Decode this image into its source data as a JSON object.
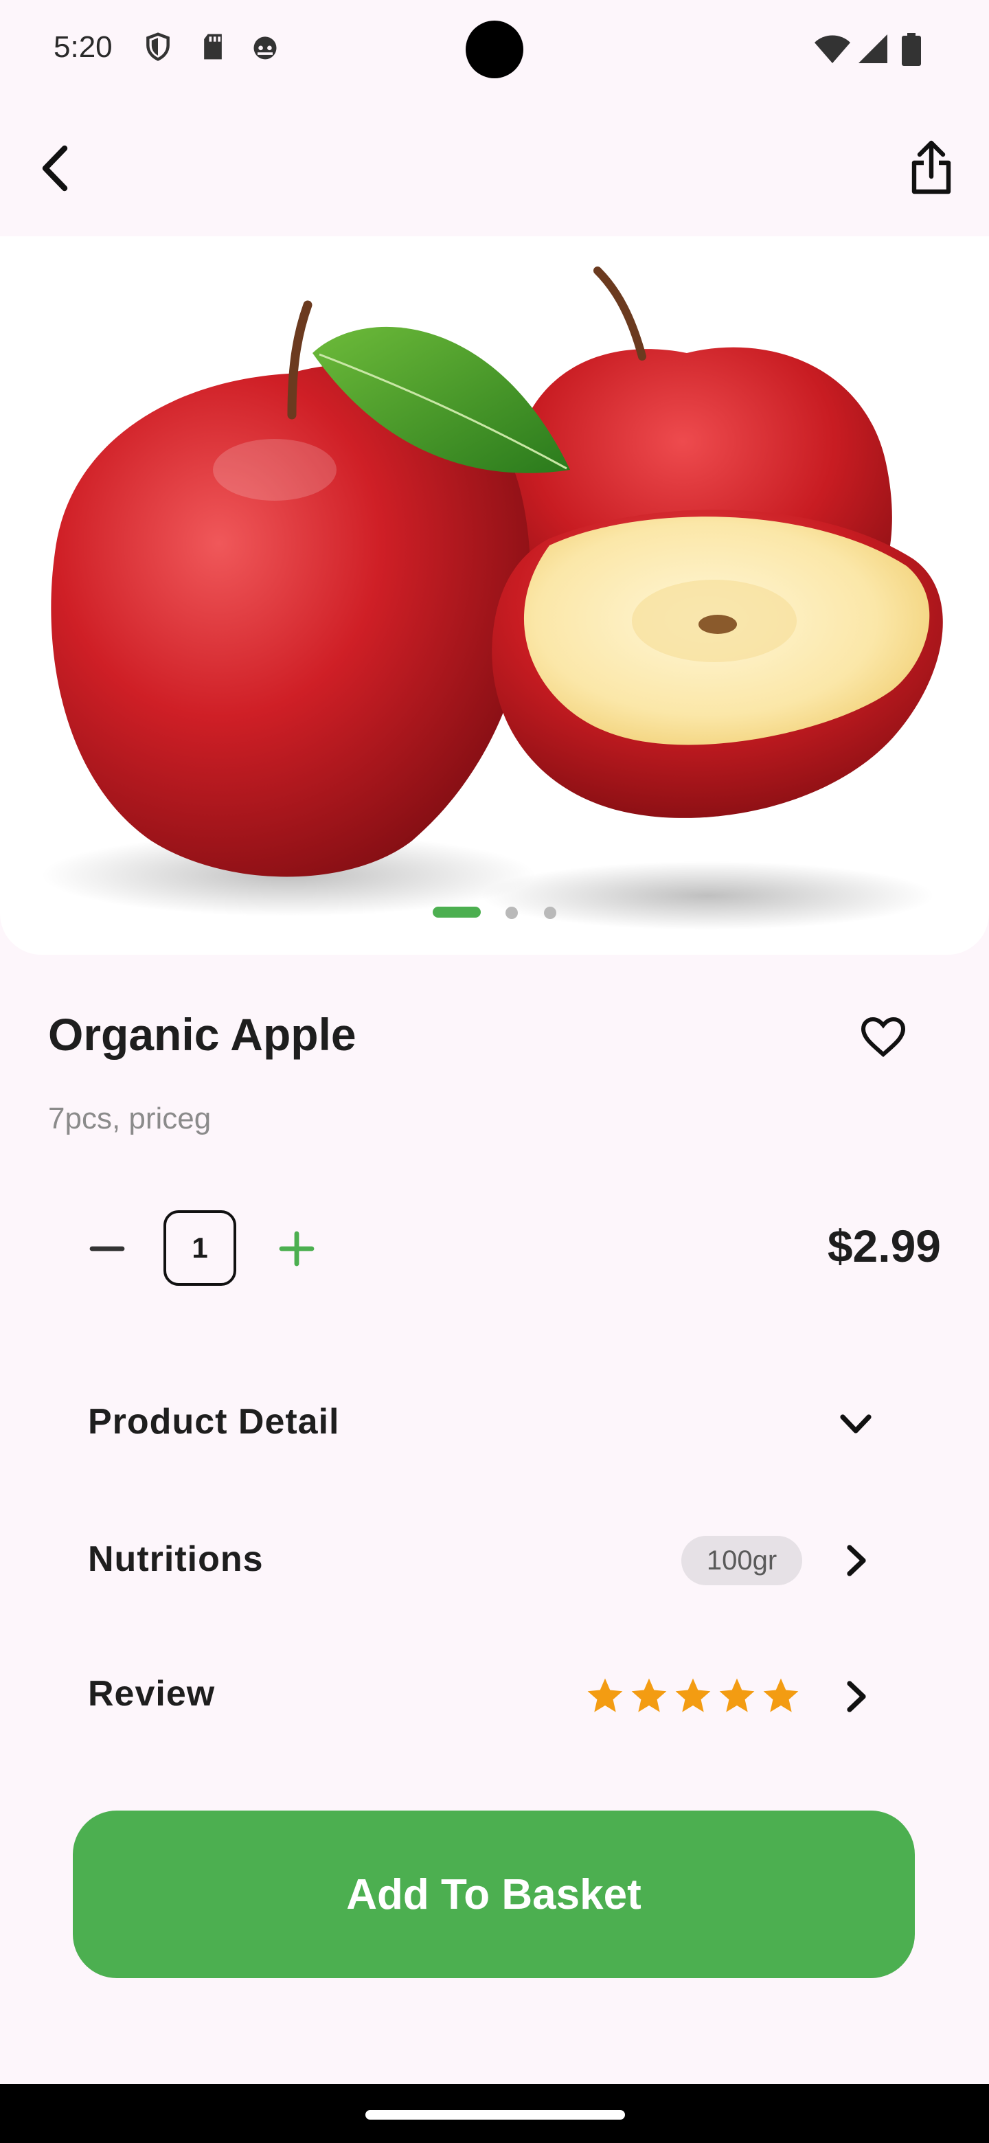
{
  "status_bar": {
    "time": "5:20",
    "left_icons": [
      "shield-icon",
      "sd-card-icon",
      "android-face-icon"
    ],
    "right_icons": [
      "wifi-icon",
      "signal-icon",
      "battery-icon"
    ]
  },
  "top_bar": {
    "back_icon": "chevron-left-icon",
    "share_icon": "share-icon"
  },
  "product": {
    "image_alt": "three red apples, one halved",
    "carousel": {
      "count": 3,
      "active_index": 0
    },
    "name": "Organic Apple",
    "subtitle": "7pcs, priceg",
    "favorite_icon": "heart-outline-icon",
    "quantity": "1",
    "price": "$2.99"
  },
  "sections": {
    "detail": {
      "label": "Product Detail",
      "icon": "chevron-down-icon"
    },
    "nutritions": {
      "label": "Nutritions",
      "badge": "100gr",
      "icon": "chevron-right-icon"
    },
    "review": {
      "label": "Review",
      "rating": 5,
      "max_rating": 5,
      "icon": "chevron-right-icon"
    }
  },
  "cta": {
    "label": "Add To Basket"
  },
  "colors": {
    "accent": "#4caf50",
    "background": "#fdf6fb",
    "star": "#f39c12",
    "pill_bg": "#e6e1e6"
  }
}
